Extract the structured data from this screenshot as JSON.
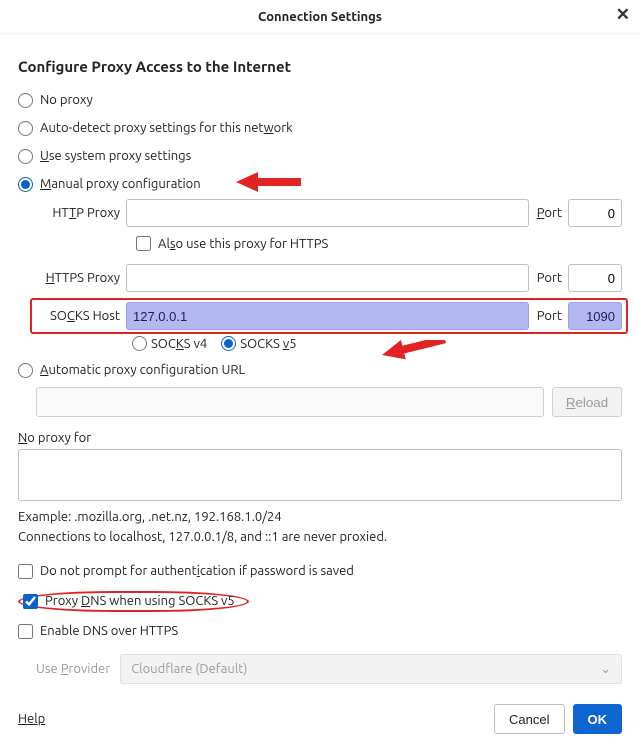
{
  "titlebar": {
    "title": "Connection Settings"
  },
  "heading": "Configure Proxy Access to the Internet",
  "radios": {
    "no_proxy": "No proxy",
    "auto_detect_pre": "Auto-detect proxy settings for this net",
    "auto_detect_u": "w",
    "auto_detect_post": "ork",
    "use_system_u": "U",
    "use_system_post": "se system proxy settings",
    "manual_u": "M",
    "manual_post": "anual proxy configuration",
    "auto_url_u": "A",
    "auto_url_post": "utomatic proxy configuration URL"
  },
  "proxy": {
    "http_label_pre": "HT",
    "http_label_u": "T",
    "http_label_post": "P Proxy",
    "http_host": "",
    "http_port_label_u": "P",
    "http_port_label_post": "ort",
    "http_port": "0",
    "also_https_pre": "Al",
    "also_https_u": "s",
    "also_https_post": "o use this proxy for HTTPS",
    "https_label_u": "H",
    "https_label_post": "TTPS Proxy",
    "https_host": "",
    "https_port_label": "Port",
    "https_port": "0",
    "socks_label_pre": "SO",
    "socks_label_u": "C",
    "socks_label_post": "KS Host",
    "socks_host": "127.0.0.1",
    "socks_port_label": "Port",
    "socks_port": "1090",
    "socks_v4_pre": "SOC",
    "socks_v4_u": "K",
    "socks_v4_post": "S v4",
    "socks_v5_pre": "SOCKS ",
    "socks_v5_u": "v",
    "socks_v5_post": "5"
  },
  "reload_label_u": "R",
  "reload_label_post": "eload",
  "noproxy": {
    "label_u": "N",
    "label_post": "o proxy for",
    "value": "",
    "example": "Example: .mozilla.org, .net.nz, 192.168.1.0/24",
    "note": "Connections to localhost, 127.0.0.1/8, and ::1 are never proxied."
  },
  "checks": {
    "noprompt_pre": "Do not prompt for authent",
    "noprompt_u": "i",
    "noprompt_post": "cation if password is saved",
    "proxydns_pre": "Proxy ",
    "proxydns_u": "D",
    "proxydns_post": "NS when using SOCKS v5",
    "enablednshttps": "Enable DNS over HTTPS"
  },
  "provider": {
    "label_pre": "Use ",
    "label_u": "P",
    "label_post": "rovider",
    "value": "Cloudflare (Default)"
  },
  "footer": {
    "help": "Help",
    "cancel": "Cancel",
    "ok": "OK"
  }
}
